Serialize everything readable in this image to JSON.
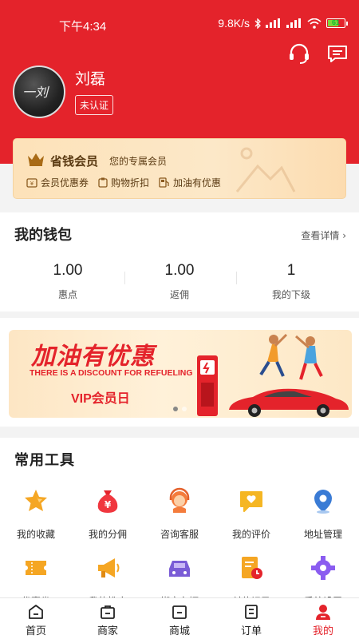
{
  "status_bar": {
    "time": "下午4:34",
    "network_speed": "9.8K/s",
    "battery": "61"
  },
  "header": {
    "customer_service_icon": "headset-icon",
    "message_icon": "message-icon"
  },
  "profile": {
    "name": "刘磊",
    "status": "未认证",
    "avatar_text": "一刘"
  },
  "vip": {
    "title": "省钱会员",
    "subtitle": "您的专属会员",
    "benefits": [
      {
        "label": "会员优惠券",
        "icon": "coupon-icon"
      },
      {
        "label": "购物折扣",
        "icon": "discount-icon"
      },
      {
        "label": "加油有优惠",
        "icon": "fuel-icon"
      }
    ]
  },
  "wallet": {
    "title": "我的钱包",
    "detail_link": "查看详情",
    "stats": [
      {
        "value": "1.00",
        "label": "惠点"
      },
      {
        "value": "1.00",
        "label": "返佣"
      },
      {
        "value": "1",
        "label": "我的下级"
      }
    ]
  },
  "banner": {
    "title": "加油有优惠",
    "subtitle": "THERE IS A DISCOUNT FOR REFUELING",
    "vip_text": "VIP会员日",
    "slide_count": 2,
    "active_slide": 0
  },
  "tools": {
    "title": "常用工具",
    "items": [
      {
        "label": "我的收藏",
        "icon": "star-icon"
      },
      {
        "label": "我的分佣",
        "icon": "money-bag-icon"
      },
      {
        "label": "咨询客服",
        "icon": "customer-service-icon"
      },
      {
        "label": "我的评价",
        "icon": "review-icon"
      },
      {
        "label": "地址管理",
        "icon": "location-pin-icon"
      },
      {
        "label": "优惠券",
        "icon": "ticket-icon"
      },
      {
        "label": "我的推广",
        "icon": "megaphone-icon"
      },
      {
        "label": "绑定车辆",
        "icon": "car-icon"
      },
      {
        "label": "付款记录",
        "icon": "payment-record-icon"
      },
      {
        "label": "系统设置",
        "icon": "settings-gear-icon"
      }
    ]
  },
  "tab_bar": {
    "tabs": [
      {
        "label": "首页",
        "icon": "home-icon"
      },
      {
        "label": "商家",
        "icon": "merchant-icon"
      },
      {
        "label": "商城",
        "icon": "mall-icon"
      },
      {
        "label": "订单",
        "icon": "order-icon"
      },
      {
        "label": "我的",
        "icon": "profile-icon"
      }
    ],
    "active": "我的"
  },
  "colors": {
    "primary": "#e4232b",
    "vip_text": "#5a3a12",
    "vip_bg": "#fde2b9"
  }
}
